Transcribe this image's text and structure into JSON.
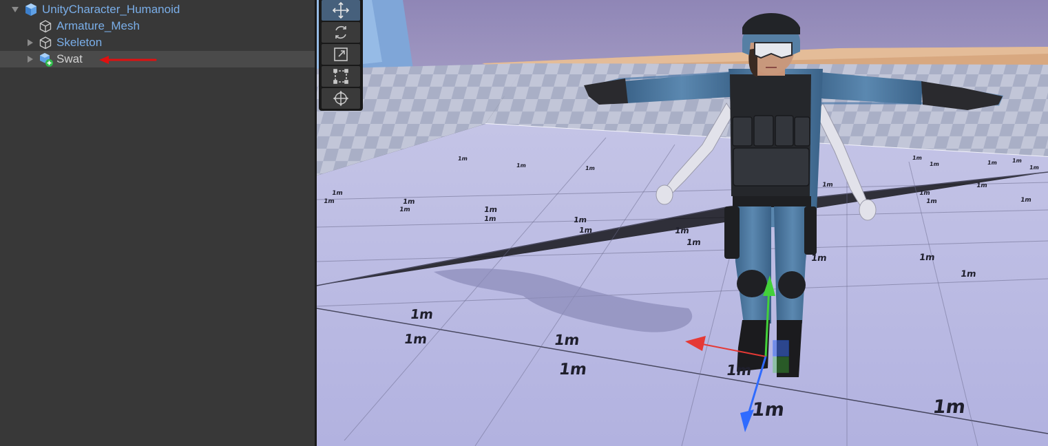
{
  "hierarchy": {
    "items": [
      {
        "label": "UnityCharacter_Humanoid",
        "icon": "prefab-icon",
        "expanded": true,
        "depth": 0,
        "style": "prefab"
      },
      {
        "label": "Armature_Mesh",
        "icon": "prefab-cube-icon",
        "expanded": false,
        "depth": 1,
        "style": "prefab"
      },
      {
        "label": "Skeleton",
        "icon": "prefab-cube-icon",
        "expanded": false,
        "depth": 1,
        "style": "prefab"
      },
      {
        "label": "Swat",
        "icon": "prefab-added-icon",
        "expanded": false,
        "depth": 1,
        "style": "plain",
        "selected": true
      }
    ],
    "annotation": "red-arrow-pointing-to-swat"
  },
  "scene": {
    "grid_labels": [
      "1m",
      "1m",
      "1m",
      "1m",
      "1m",
      "1m",
      "1m",
      "1m",
      "1m",
      "1m",
      "1m",
      "1m",
      "1m",
      "1m",
      "1m",
      "1m",
      "1m",
      "1m",
      "1m",
      "1m",
      "1m",
      "1m",
      "1m",
      "1m",
      "1m",
      "1m",
      "1m",
      "1m",
      "1m",
      "1m",
      "1m",
      "1m",
      "1m"
    ],
    "gizmo": {
      "x_color": "#e53935",
      "y_color": "#43d13a",
      "z_color": "#2f6bff"
    }
  },
  "toolbar": {
    "tools": [
      {
        "name": "move-tool",
        "active": true
      },
      {
        "name": "rotate-tool",
        "active": false
      },
      {
        "name": "scale-tool",
        "active": false
      },
      {
        "name": "rect-tool",
        "active": false
      },
      {
        "name": "transform-tool",
        "active": false
      }
    ]
  },
  "colors": {
    "prefab_text": "#7aaee8",
    "plain_text": "#d2d2d2",
    "panel_bg": "#383838",
    "annotation_arrow": "#e01010"
  }
}
